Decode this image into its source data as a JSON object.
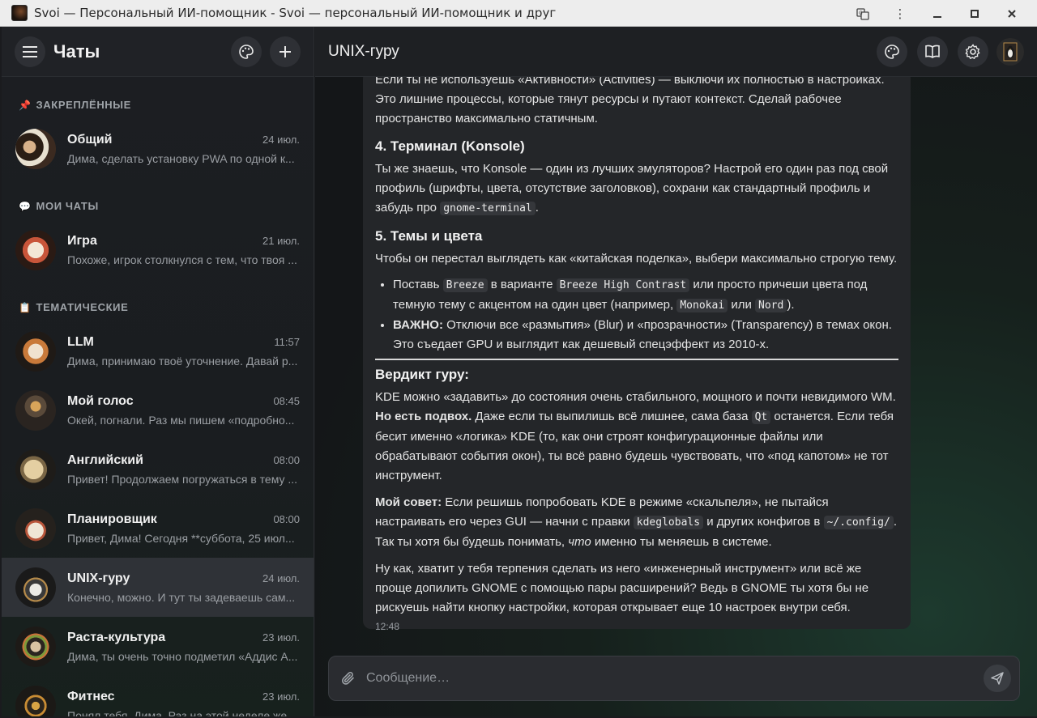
{
  "window": {
    "title": "Svoi — Персональный ИИ-помощник - Svoi — персональный ИИ-помощник и друг"
  },
  "sidebar": {
    "title": "Чаты",
    "sections": [
      {
        "icon": "📌",
        "label": "ЗАКРЕПЛЁННЫЕ"
      },
      {
        "icon": "💬",
        "label": "МОИ ЧАТЫ"
      },
      {
        "icon": "📋",
        "label": "ТЕМАТИЧЕСКИЕ"
      }
    ],
    "chats": [
      {
        "name": "Общий",
        "time": "24 июл.",
        "preview": "Дима, сделать установку PWA по одной к..."
      },
      {
        "name": "Игра",
        "time": "21 июл.",
        "preview": "Похоже, игрок столкнулся с тем, что твоя ..."
      },
      {
        "name": "LLM",
        "time": "11:57",
        "preview": "Дима, принимаю твоё уточнение. Давай р..."
      },
      {
        "name": "Мой голос",
        "time": "08:45",
        "preview": "Окей, погнали. Раз мы пишем «подробно..."
      },
      {
        "name": "Английский",
        "time": "08:00",
        "preview": "Привет! Продолжаем погружаться в тему ..."
      },
      {
        "name": "Планировщик",
        "time": "08:00",
        "preview": "Привет, Дима! Сегодня **суббота, 25 июл..."
      },
      {
        "name": "UNIX-гуру",
        "time": "24 июл.",
        "preview": "Конечно, можно. И тут ты задеваешь сам..."
      },
      {
        "name": "Раста-культура",
        "time": "23 июл.",
        "preview": "Дима, ты очень точно подметил «Аддис А..."
      },
      {
        "name": "Фитнес",
        "time": "23 июл.",
        "preview": "Понял тебя, Дима. Раз на этой неделе же..."
      }
    ]
  },
  "main": {
    "title": "UNIX-гуру",
    "message": {
      "p1": "Если ты не используешь «Активности» (Activities) — выключи их полностью в настройках. Это лишние процессы, которые тянут ресурсы и путают контекст. Сделай рабочее пространство максимально статичным.",
      "h4": "4. Терминал (Konsole)",
      "p2a": "Ты же знаешь, что Konsole — один из лучших эмуляторов? Настрой его один раз под свой профиль (шрифты, цвета, отсутствие заголовков), сохрани как стандартный профиль и забудь про ",
      "p2code": "gnome-terminal",
      "p2end": ".",
      "h5": "5. Темы и цвета",
      "p3": "Чтобы он перестал выглядеть как «китайская поделка», выбери максимально строгую тему.",
      "li1a": "Поставь ",
      "li1c1": "Breeze",
      "li1b": " в варианте ",
      "li1c2": "Breeze High Contrast",
      "li1c": " или просто причеши цвета под темную тему с акцентом на один цвет (например, ",
      "li1c3": "Monokai",
      "li1d": " или ",
      "li1c4": "Nord",
      "li1e": ").",
      "li2b": "ВАЖНО:",
      "li2": " Отключи все «размытия» (Blur) и «прозрачности» (Transparency) в темах окон. Это съедает GPU и выглядит как дешевый спецэффект из 2010-х.",
      "verdict": "Вердикт гуру:",
      "p4": "KDE можно «задавить» до состояния очень стабильного, мощного и почти невидимого WM.",
      "p5b": "Но есть подвох.",
      "p5a": " Даже если ты выпилишь всё лишнее, сама база ",
      "p5code": "Qt",
      "p5c": " останется. Если тебя бесит именно «логика» KDE (то, как они строят конфигурационные файлы или обрабатывают события окон), ты всё равно будешь чувствовать, что «под капотом» не тот инструмент.",
      "p6b": "Мой совет:",
      "p6a": " Если решишь попробовать KDE в режиме «скальпеля», не пытайся настраивать его через GUI — начни с правки ",
      "p6c1": "kdeglobals",
      "p6c": " и других конфигов в ",
      "p6c2": "~/.config/",
      "p6d": ". Так ты хотя бы будешь понимать, ",
      "p6i": "что",
      "p6e": " именно ты меняешь в системе.",
      "p7": "Ну как, хватит у тебя терпения сделать из него «инженерный инструмент» или всё же проще допилить GNOME с помощью пары расширений? Ведь в GNOME ты хотя бы не рискуешь найти кнопку настройки, которая открывает еще 10 настроек внутри себя.",
      "time": "12:48"
    },
    "composer": {
      "placeholder": "Сообщение…"
    }
  }
}
